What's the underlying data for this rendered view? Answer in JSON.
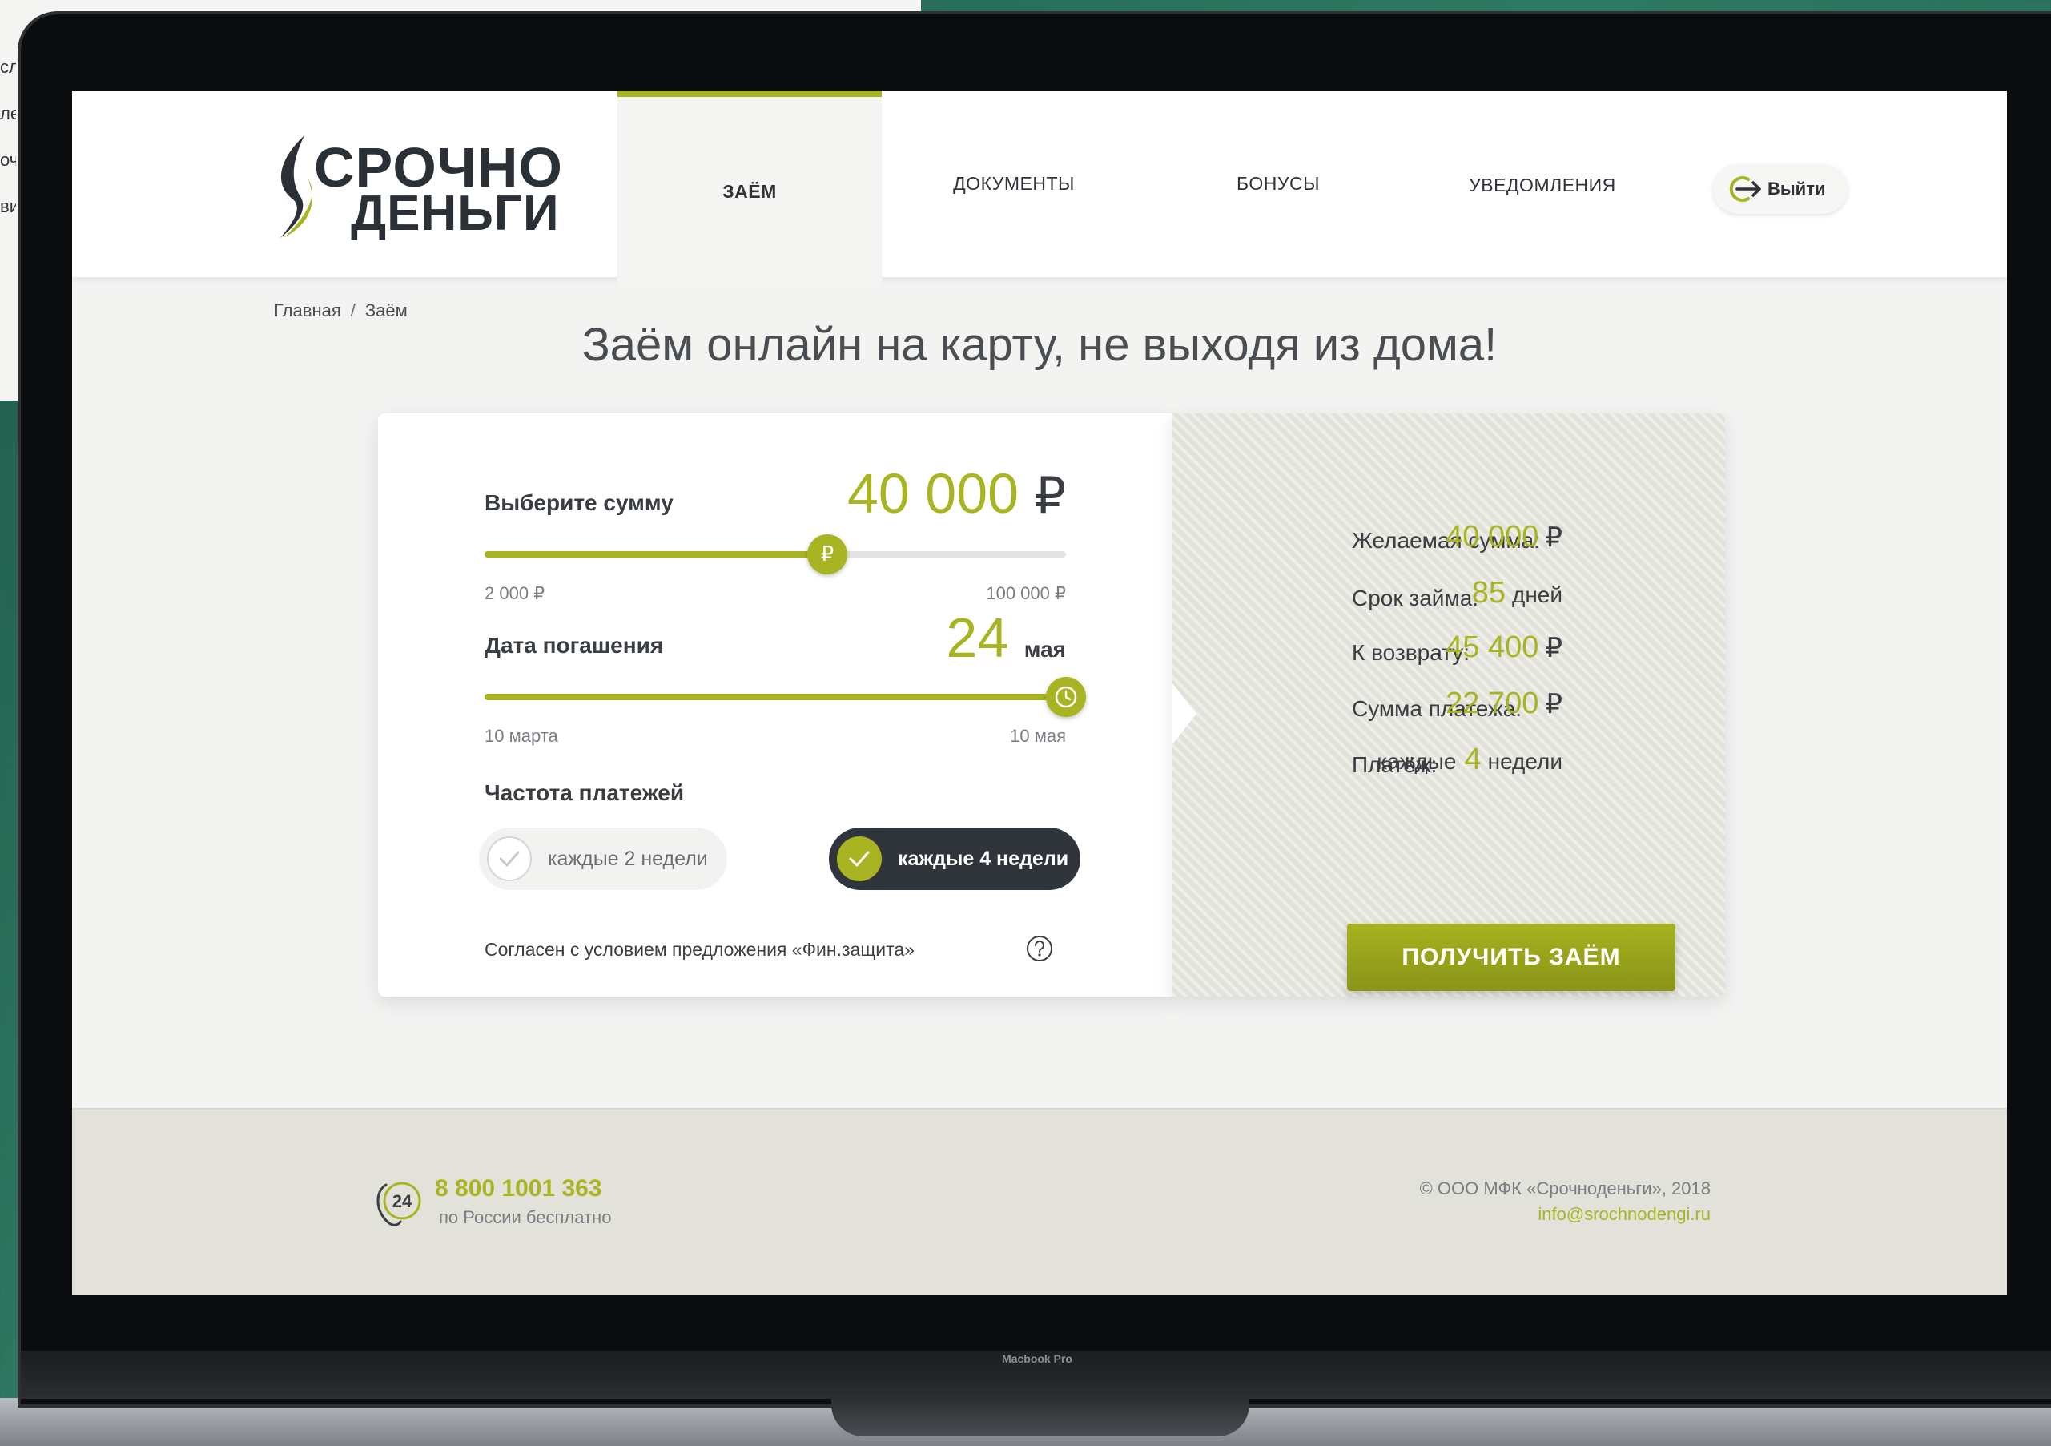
{
  "background_window": {
    "fragments": [
      "сл",
      "ле",
      "оч",
      "вит"
    ]
  },
  "device": {
    "label": "Macbook Pro"
  },
  "brand": {
    "logo_line1": "СРОЧНО",
    "logo_line2": "ДЕНЬГИ",
    "accent_color": "#a9b423",
    "dark_color": "#2f353b"
  },
  "nav": {
    "items": [
      {
        "label": "ЗАЁМ",
        "active": true
      },
      {
        "label": "ДОКУМЕНТЫ",
        "active": false
      },
      {
        "label": "БОНУСЫ",
        "active": false
      },
      {
        "label": "УВЕДОМЛЕНИЯ",
        "active": false
      }
    ],
    "logout_label": "Выйти"
  },
  "breadcrumb": {
    "home": "Главная",
    "separator": "/",
    "current": "Заём"
  },
  "page_title": "Заём онлайн на карту, не выходя из дома!",
  "calculator": {
    "amount": {
      "label": "Выберите сумму",
      "value": "40 000",
      "unit": "₽",
      "min_label": "2 000 ₽",
      "max_label": "100 000 ₽",
      "slider_fraction": 0.59,
      "thumb_icon": "ruble-icon"
    },
    "date": {
      "label": "Дата погашения",
      "value": "24",
      "unit": "мая",
      "min_label": "10 марта",
      "max_label": "10 мая",
      "slider_fraction": 1.0,
      "thumb_icon": "clock-icon"
    },
    "frequency": {
      "label": "Частота платежей",
      "options": [
        {
          "label": "каждые 2 недели",
          "selected": false
        },
        {
          "label": "каждые 4 недели",
          "selected": true
        }
      ]
    },
    "agreement_text": "Согласен с условием предложения «Фин.защита»"
  },
  "summary": {
    "rows": [
      {
        "label": "Желаемая сумма:",
        "value": "40 000",
        "unit": "₽"
      },
      {
        "label": "Срок займа:",
        "value": "85",
        "unit": "дней"
      },
      {
        "label": "К возврату:",
        "value": "45 400",
        "unit": "₽"
      },
      {
        "label": "Сумма платежа:",
        "value": "22 700",
        "unit": "₽"
      },
      {
        "label": "Платёж:",
        "prefix": "каждые",
        "value": "4",
        "unit": "недели"
      }
    ],
    "cta_label": "ПОЛУЧИТЬ ЗАЁМ"
  },
  "footer": {
    "phone_badge": "24",
    "phone": "8 800 1001 363",
    "phone_note": "по России бесплатно",
    "copyright": "© ООО МФК «Срочноденьги», 2018",
    "email": "info@srochnodengi.ru"
  }
}
